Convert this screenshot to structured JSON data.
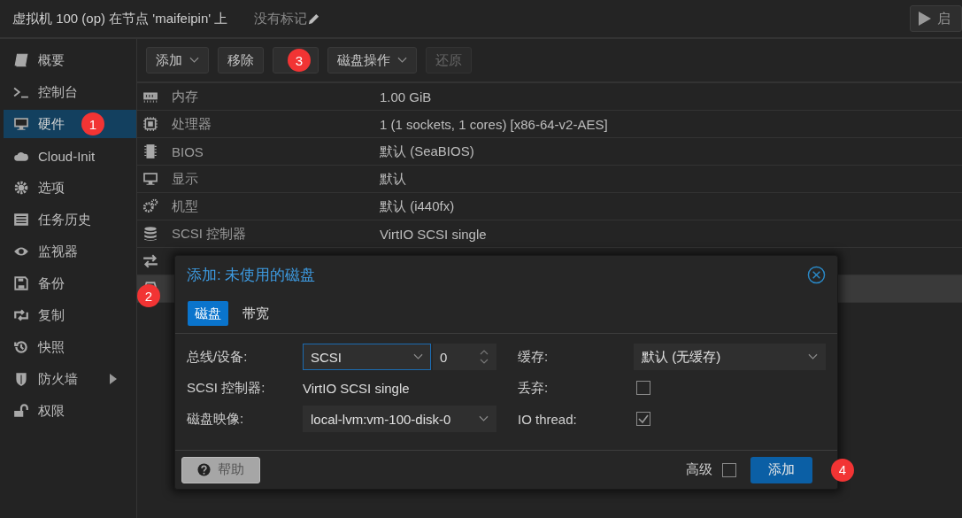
{
  "header": {
    "title": "虚拟机 100 (op) 在节点 'maifeipin' 上",
    "tags": "没有标记",
    "start_button": "启"
  },
  "sidebar": {
    "items": [
      {
        "label": "概要",
        "selected": false,
        "submenu": false
      },
      {
        "label": "控制台",
        "selected": false,
        "submenu": false
      },
      {
        "label": "硬件",
        "selected": true,
        "submenu": false,
        "badge": "1"
      },
      {
        "label": "Cloud-Init",
        "selected": false,
        "submenu": false
      },
      {
        "label": "选项",
        "selected": false,
        "submenu": false
      },
      {
        "label": "任务历史",
        "selected": false,
        "submenu": false
      },
      {
        "label": "监视器",
        "selected": false,
        "submenu": false
      },
      {
        "label": "备份",
        "selected": false,
        "submenu": false
      },
      {
        "label": "复制",
        "selected": false,
        "submenu": false
      },
      {
        "label": "快照",
        "selected": false,
        "submenu": false
      },
      {
        "label": "防火墙",
        "selected": false,
        "submenu": true
      },
      {
        "label": "权限",
        "selected": false,
        "submenu": false
      }
    ]
  },
  "toolbar": {
    "buttons": [
      {
        "label": "添加",
        "menu": true,
        "disabled": false
      },
      {
        "label": "移除",
        "menu": false,
        "disabled": false
      },
      {
        "menu": false,
        "disabled": false,
        "badge": "3"
      },
      {
        "label": "磁盘操作",
        "menu": true,
        "disabled": false
      },
      {
        "label": "还原",
        "menu": false,
        "disabled": true
      }
    ]
  },
  "hardware": {
    "rows": [
      {
        "label": "内存",
        "value": "1.00 GiB",
        "selected": false
      },
      {
        "label": "处理器",
        "value": "1 (1 sockets, 1 cores) [x86-64-v2-AES]",
        "selected": false
      },
      {
        "label": "BIOS",
        "value": "默认 (SeaBIOS)",
        "selected": false
      },
      {
        "label": "显示",
        "value": "默认",
        "selected": false
      },
      {
        "label": "机型",
        "value": "默认 (i440fx)",
        "selected": false
      },
      {
        "label": "SCSI 控制器",
        "value": "VirtIO SCSI single",
        "selected": false
      },
      {
        "selected": false
      },
      {
        "selected": true,
        "badge": "2"
      }
    ]
  },
  "dialog": {
    "title": "添加: 未使用的磁盘",
    "tabs": [
      {
        "label": "磁盘",
        "selected": true
      },
      {
        "label": "带宽",
        "selected": false
      }
    ],
    "left_fields": [
      {
        "kind": "combo",
        "label": "总线/设备:",
        "value": "SCSI",
        "spin_value": "0",
        "focused": true
      },
      {
        "kind": "text",
        "label": "SCSI 控制器:",
        "value": "VirtIO SCSI single"
      },
      {
        "kind": "select",
        "label": "磁盘映像:",
        "value": "local-lvm:vm-100-disk-0",
        "focused": false
      }
    ],
    "right_fields": [
      {
        "kind": "select",
        "label": "缓存:",
        "value": "默认 (无缓存)",
        "focused": false
      },
      {
        "kind": "checkbox",
        "label": "丢弃:",
        "checked": false
      },
      {
        "kind": "checkbox",
        "label": "IO thread:",
        "checked": true
      }
    ],
    "help_button": "帮助",
    "advanced": {
      "label": "高级",
      "checked": false
    },
    "add_button": {
      "label": "添加",
      "badge": "4"
    }
  }
}
